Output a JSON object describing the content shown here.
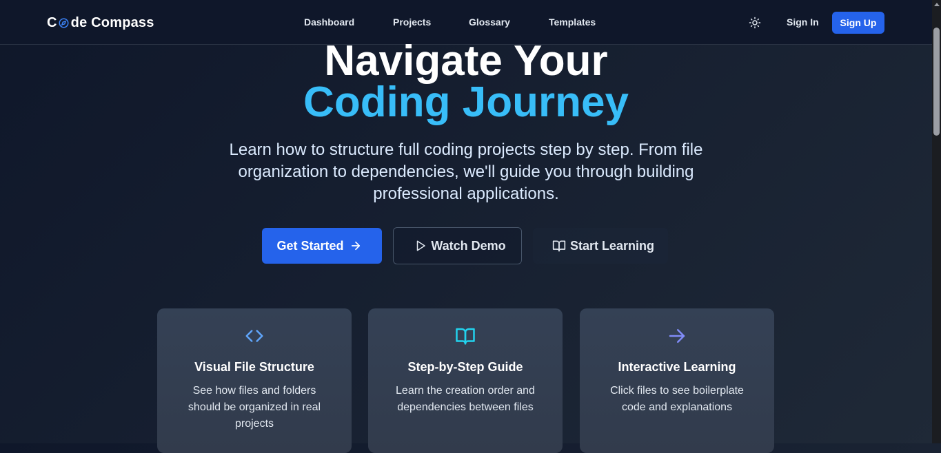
{
  "navbar": {
    "logo_prefix": "C",
    "logo_suffix": "de Compass",
    "links": [
      "Dashboard",
      "Projects",
      "Glossary",
      "Templates"
    ],
    "sign_in": "Sign In",
    "sign_up": "Sign Up"
  },
  "hero": {
    "title_line1": "Navigate Your",
    "title_line2": "Coding Journey",
    "subtitle": "Learn how to structure full coding projects step by step. From file organization to dependencies, we'll guide you through building professional applications."
  },
  "actions": {
    "get_started": "Get Started",
    "watch_demo": "Watch Demo",
    "start_learning": "Start Learning"
  },
  "features": [
    {
      "icon": "code-icon",
      "title": "Visual File Structure",
      "desc": "See how files and folders should be organized in real projects"
    },
    {
      "icon": "book-open-icon",
      "title": "Step-by-Step Guide",
      "desc": "Learn the creation order and dependencies between files"
    },
    {
      "icon": "arrow-right-icon",
      "title": "Interactive Learning",
      "desc": "Click files to see boilerplate code and explanations"
    }
  ],
  "colors": {
    "accent": "#2563eb",
    "title_highlight": "#38bdf8",
    "icon_blue": "#60a5fa",
    "icon_cyan": "#22d3ee",
    "icon_indigo": "#818cf8"
  }
}
